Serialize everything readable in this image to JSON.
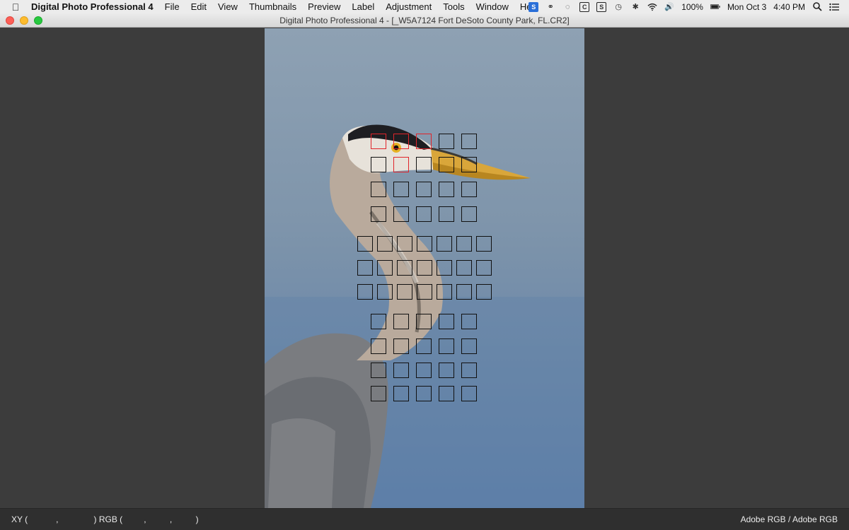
{
  "menubar": {
    "apple_icon": "apple-logo-icon",
    "app_name": "Digital Photo Professional 4",
    "items": [
      "File",
      "Edit",
      "View",
      "Thumbnails",
      "Preview",
      "Label",
      "Adjustment",
      "Tools",
      "Window",
      "Help"
    ],
    "battery": "100%",
    "date": "Mon Oct 3",
    "time": "4:40 PM"
  },
  "window": {
    "title": "Digital Photo Professional 4 - [_W5A7124  Fort DeSoto County Park, FL.CR2]"
  },
  "statusbar": {
    "xy_label": "XY (",
    "xy_sep": ",",
    "xy_close": ")",
    "rgb_label": "RGB (",
    "rgb_sep1": ",",
    "rgb_sep2": ",",
    "rgb_close": ")",
    "color_space": "Adobe RGB / Adobe RGB"
  },
  "af_points": {
    "total": 61,
    "active_count": 4
  }
}
